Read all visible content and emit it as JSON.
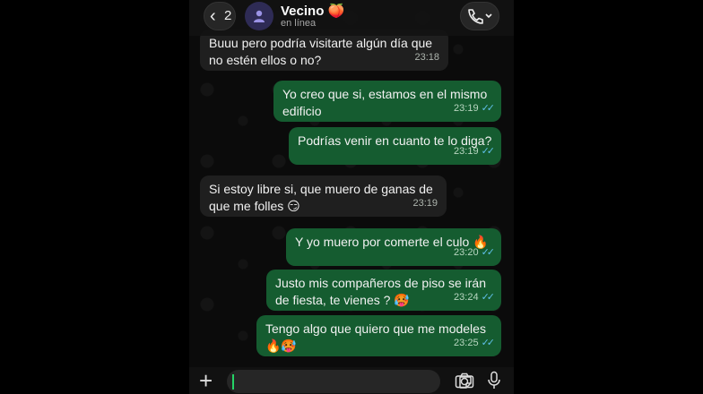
{
  "header": {
    "back_count": "2",
    "contact_name": "Vecino",
    "name_emoji": "🍑",
    "status": "en línea"
  },
  "messages": [
    {
      "dir": "in",
      "text": "Buuu pero podría visitarte algún día que\nno estén ellos o no?",
      "time": "23:18"
    },
    {
      "dir": "out",
      "text": "Yo creo que si, estamos en el mismo\nedificio",
      "time": "23:19"
    },
    {
      "dir": "out",
      "text": "Podrías venir en cuanto te lo diga?",
      "time": "23:19"
    },
    {
      "dir": "in",
      "text": "Si estoy libre si, que muero de ganas de\nque me folles 😏",
      "time": "23:19"
    },
    {
      "dir": "out",
      "text": "Y yo muero por comerte el culo 🔥",
      "time": "23:20"
    },
    {
      "dir": "out",
      "text": "Justo mis compañeros de piso se irán\nde fiesta, te vienes ? 🥵",
      "time": "23:24"
    },
    {
      "dir": "out",
      "text": "Tengo algo que quiero que me modeles\n🔥🥵",
      "time": "23:25"
    }
  ],
  "read_tick": "✓✓",
  "colors": {
    "incoming": "#1f1f1f",
    "outgoing": "#155c30",
    "tick": "#5fbfe8",
    "cursor": "#25d366"
  },
  "icons": [
    "chevron-left-icon",
    "person-icon",
    "phone-icon",
    "chevron-down-icon",
    "plus-icon",
    "sticker-icon",
    "camera-icon",
    "microphone-icon"
  ]
}
